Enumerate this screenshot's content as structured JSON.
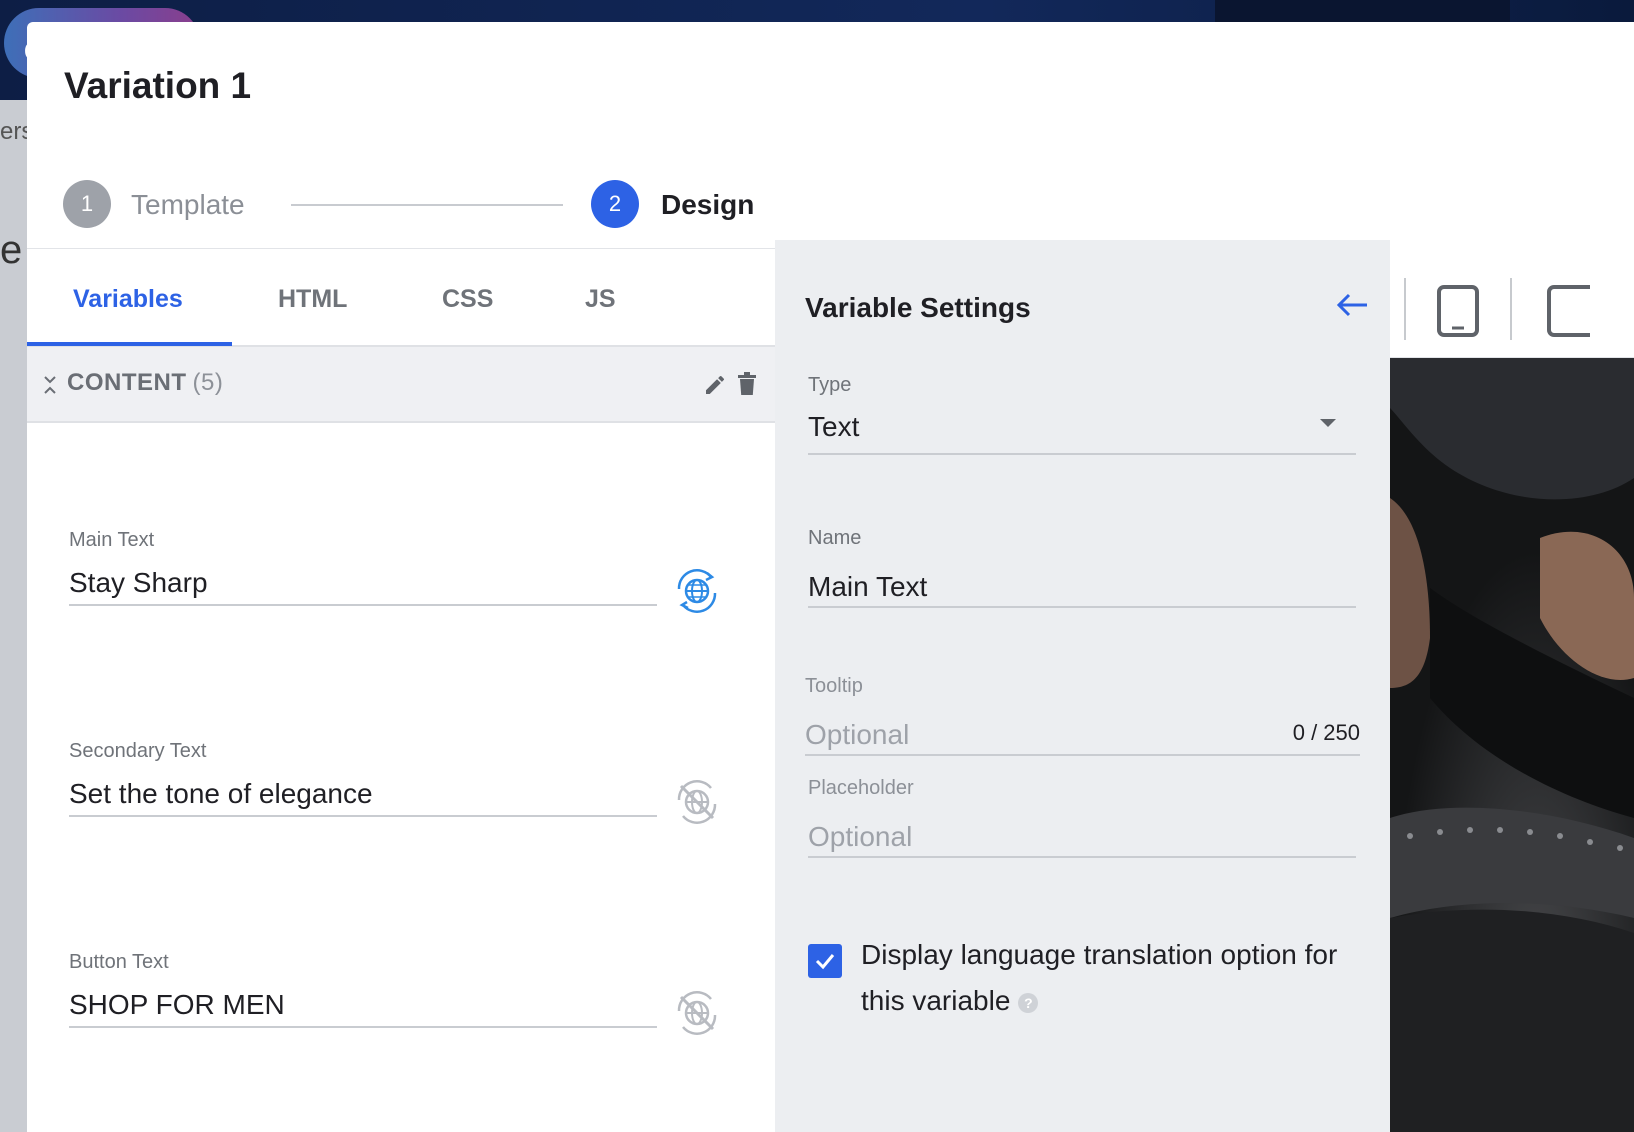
{
  "background": {
    "pill_letter": "C",
    "side_text_1": "ers",
    "side_text_2": "e"
  },
  "modal": {
    "title": "Variation 1"
  },
  "stepper": {
    "steps": [
      {
        "number": "1",
        "label": "Template",
        "state": "completed"
      },
      {
        "number": "2",
        "label": "Design",
        "state": "active"
      }
    ]
  },
  "tabs": [
    {
      "label": "Variables",
      "active": true
    },
    {
      "label": "HTML",
      "active": false
    },
    {
      "label": "CSS",
      "active": false
    },
    {
      "label": "JS",
      "active": false
    }
  ],
  "section": {
    "title": "CONTENT",
    "count": "(5)"
  },
  "variables": [
    {
      "label": "Main Text",
      "value": "Stay Sharp",
      "translation_icon": "globe-translate-icon"
    },
    {
      "label": "Secondary Text",
      "value": "Set the tone of elegance",
      "translation_icon": "translation-disabled-icon"
    },
    {
      "label": "Button Text",
      "value": "SHOP FOR MEN",
      "translation_icon": "translation-disabled-icon"
    }
  ],
  "settings": {
    "title": "Variable Settings",
    "type_label": "Type",
    "type_value": "Text",
    "name_label": "Name",
    "name_value": "Main Text",
    "tooltip_label": "Tooltip",
    "tooltip_placeholder": "Optional",
    "tooltip_count": "0 / 250",
    "placeholder_label": "Placeholder",
    "placeholder_placeholder": "Optional",
    "checkbox_checked": true,
    "checkbox_label": "Display language translation option for this variable"
  },
  "colors": {
    "accent": "#2d62e5",
    "panel_bg": "#eceef1",
    "text": "#1f1f24"
  }
}
